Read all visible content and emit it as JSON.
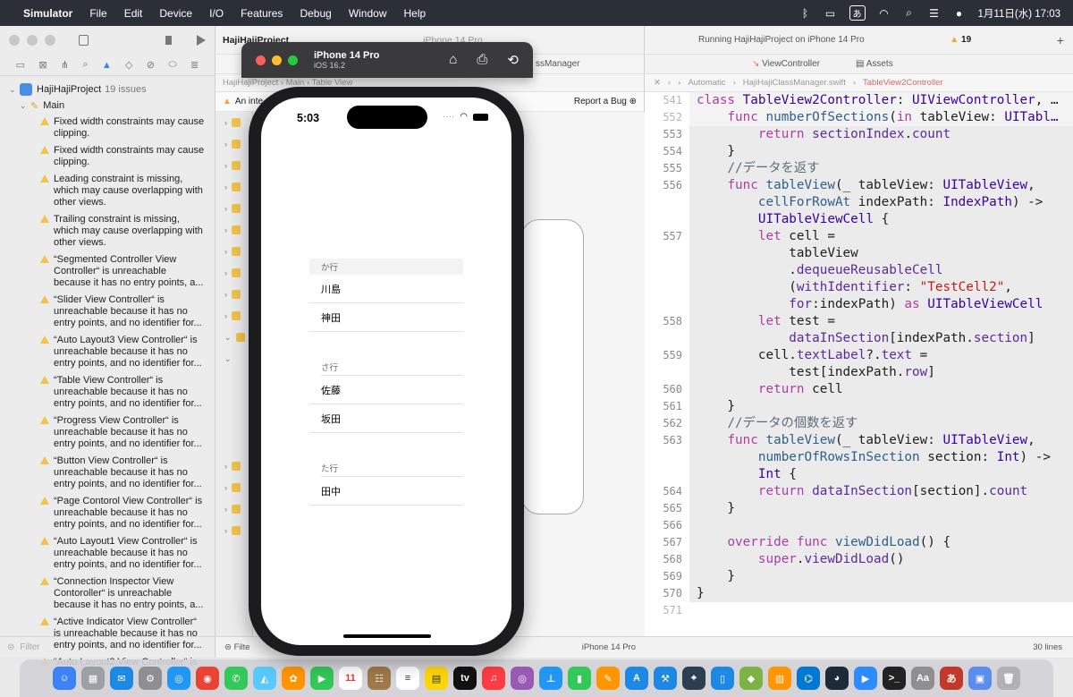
{
  "menubar": {
    "app": "Simulator",
    "items": [
      "File",
      "Edit",
      "Device",
      "I/O",
      "Features",
      "Debug",
      "Window",
      "Help"
    ],
    "kana": "あ",
    "clock": "1月11日(水) 17:03"
  },
  "navigator": {
    "project": "HajiHajiProject",
    "issue_count": "19 issues",
    "group": "Main",
    "issues": [
      "Fixed width constraints may cause clipping.",
      "Fixed width constraints may cause clipping.",
      "Leading constraint is missing, which may cause overlapping with other views.",
      "Trailing constraint is missing, which may cause overlapping with other views.",
      "“Segmented Controller View Controller“ is unreachable because it has no entry points, a...",
      "“Slider View Controller“ is unreachable because it has no entry points, and no identifier for...",
      "“Auto Layout3 View Controller“ is unreachable because it has no entry points, and no identifier for...",
      "“Table View Controller“ is unreachable because it has no entry points, and no identifier for...",
      "“Progress View Controller“ is unreachable because it has no entry points, and no identifier for...",
      "“Button View Controller“ is unreachable because it has no entry points, and no identifier for...",
      "“Page Contorol View Controller“ is unreachable because it has no entry points, and no identifier for...",
      "“Auto Layout1 View Controller“ is unreachable because it has no entry points, and no identifier for...",
      "“Connection Inspector View Contoroller“ is unreachable because it has no entry points, a...",
      "“Active Indicator View Controller“ is unreachable because it has no entry points, and no identifier for...",
      "“Auto Layout2 View Controller“ is"
    ],
    "filter_placeholder": "Filter"
  },
  "toolbar": {
    "project_title": "HajiHajiProject",
    "device_short": "iPhone 14 Pro",
    "running_status": "Running HajiHajiProject on iPhone 14 Pro",
    "warning_count": "19",
    "tab_manager": "ssManager",
    "tab_viewcontroller": "ViewController",
    "tab_assets": "Assets"
  },
  "middle": {
    "crumbs": "HajiHajiProject  ›  Main  ›  Table View",
    "banner": "An inte",
    "report_bug": "Report a Bug",
    "bottom_device": "iPhone 14 Pro"
  },
  "editor": {
    "crumbs_mode": "Automatic",
    "crumbs_file": "HajiHajiClassManager.swift",
    "crumbs_class": "TableView2Controller",
    "line_count": "30 lines"
  },
  "simulator": {
    "device": "iPhone 14 Pro",
    "os": "iOS 16.2",
    "time": "5:03",
    "sections": [
      {
        "header": "か行",
        "rows": [
          "川島",
          "神田"
        ]
      },
      {
        "header": "さ行",
        "rows": [
          "佐藤",
          "坂田"
        ]
      },
      {
        "header": "た行",
        "rows": [
          "田中"
        ]
      }
    ]
  },
  "colors": {
    "menubar": "#2a2f38",
    "keyword": "#ad3da4",
    "type": "#3900a0",
    "string": "#c41a16",
    "warning": "#f2c14e"
  }
}
